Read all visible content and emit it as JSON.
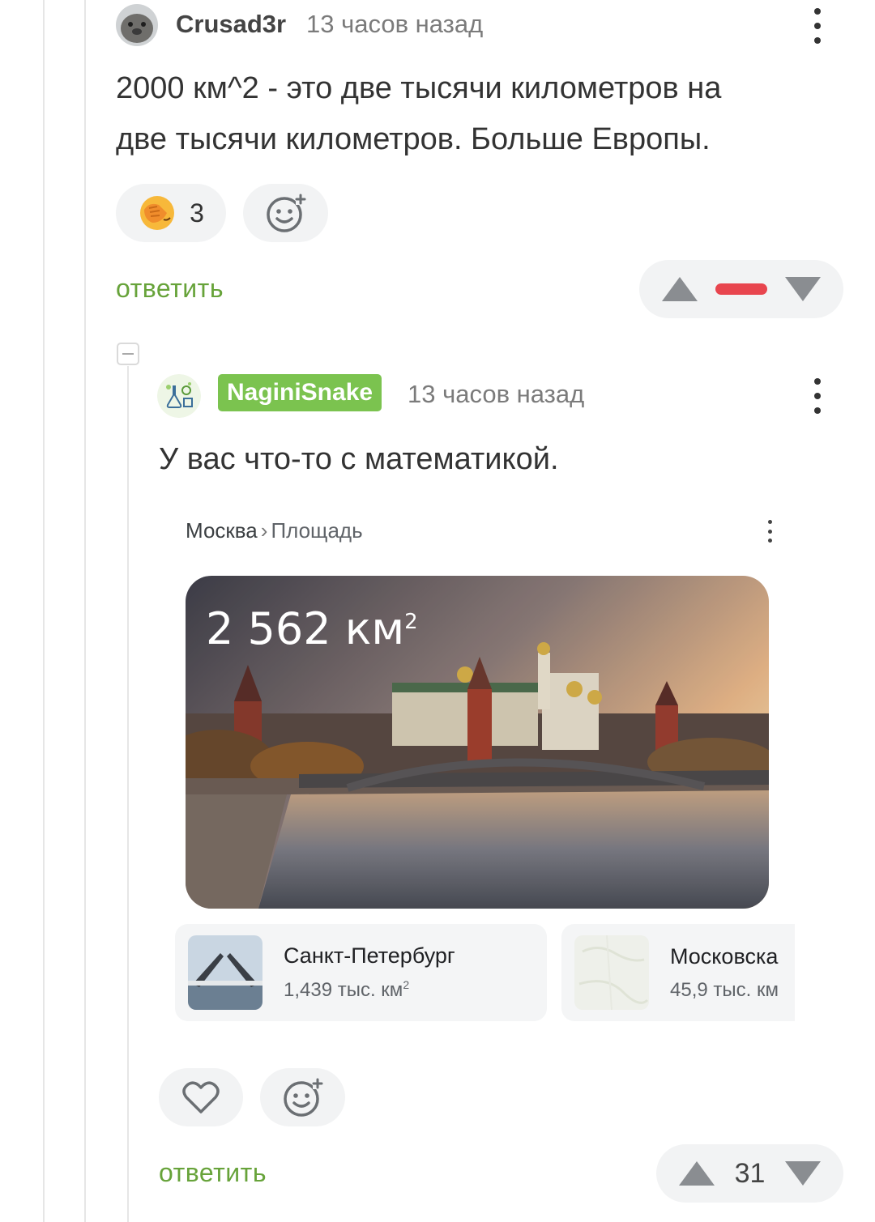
{
  "comment1": {
    "username": "Crusad3r",
    "time": "13 часов назад",
    "avatar_icon": "seal-avatar-icon",
    "text_line1": "2000 км^2 - это две тысячи километров на",
    "text_line2": "две тысячи километров. Больше Европы.",
    "reaction_count": "3",
    "reaction_icon": "facepalm-emoji-icon",
    "reply_label": "ответить",
    "rating_color": "#e8454e"
  },
  "comment2": {
    "username": "NaginiSnake",
    "time": "13 часов назад",
    "avatar_icon": "science-doodle-avatar-icon",
    "text": "У вас что-то с математикой.",
    "reply_label": "ответить",
    "rating": "31",
    "embed": {
      "breadcrumb_main": "Москва",
      "breadcrumb_sep": "›",
      "breadcrumb_sub": "Площадь",
      "area_value": "2 562 км",
      "area_sup": "2",
      "cards": [
        {
          "title": "Санкт-Петербург",
          "value": "1,439 тыс. км",
          "sup": "2"
        },
        {
          "title": "Московска",
          "value": "45,9 тыс. км",
          "sup": ""
        }
      ]
    }
  }
}
